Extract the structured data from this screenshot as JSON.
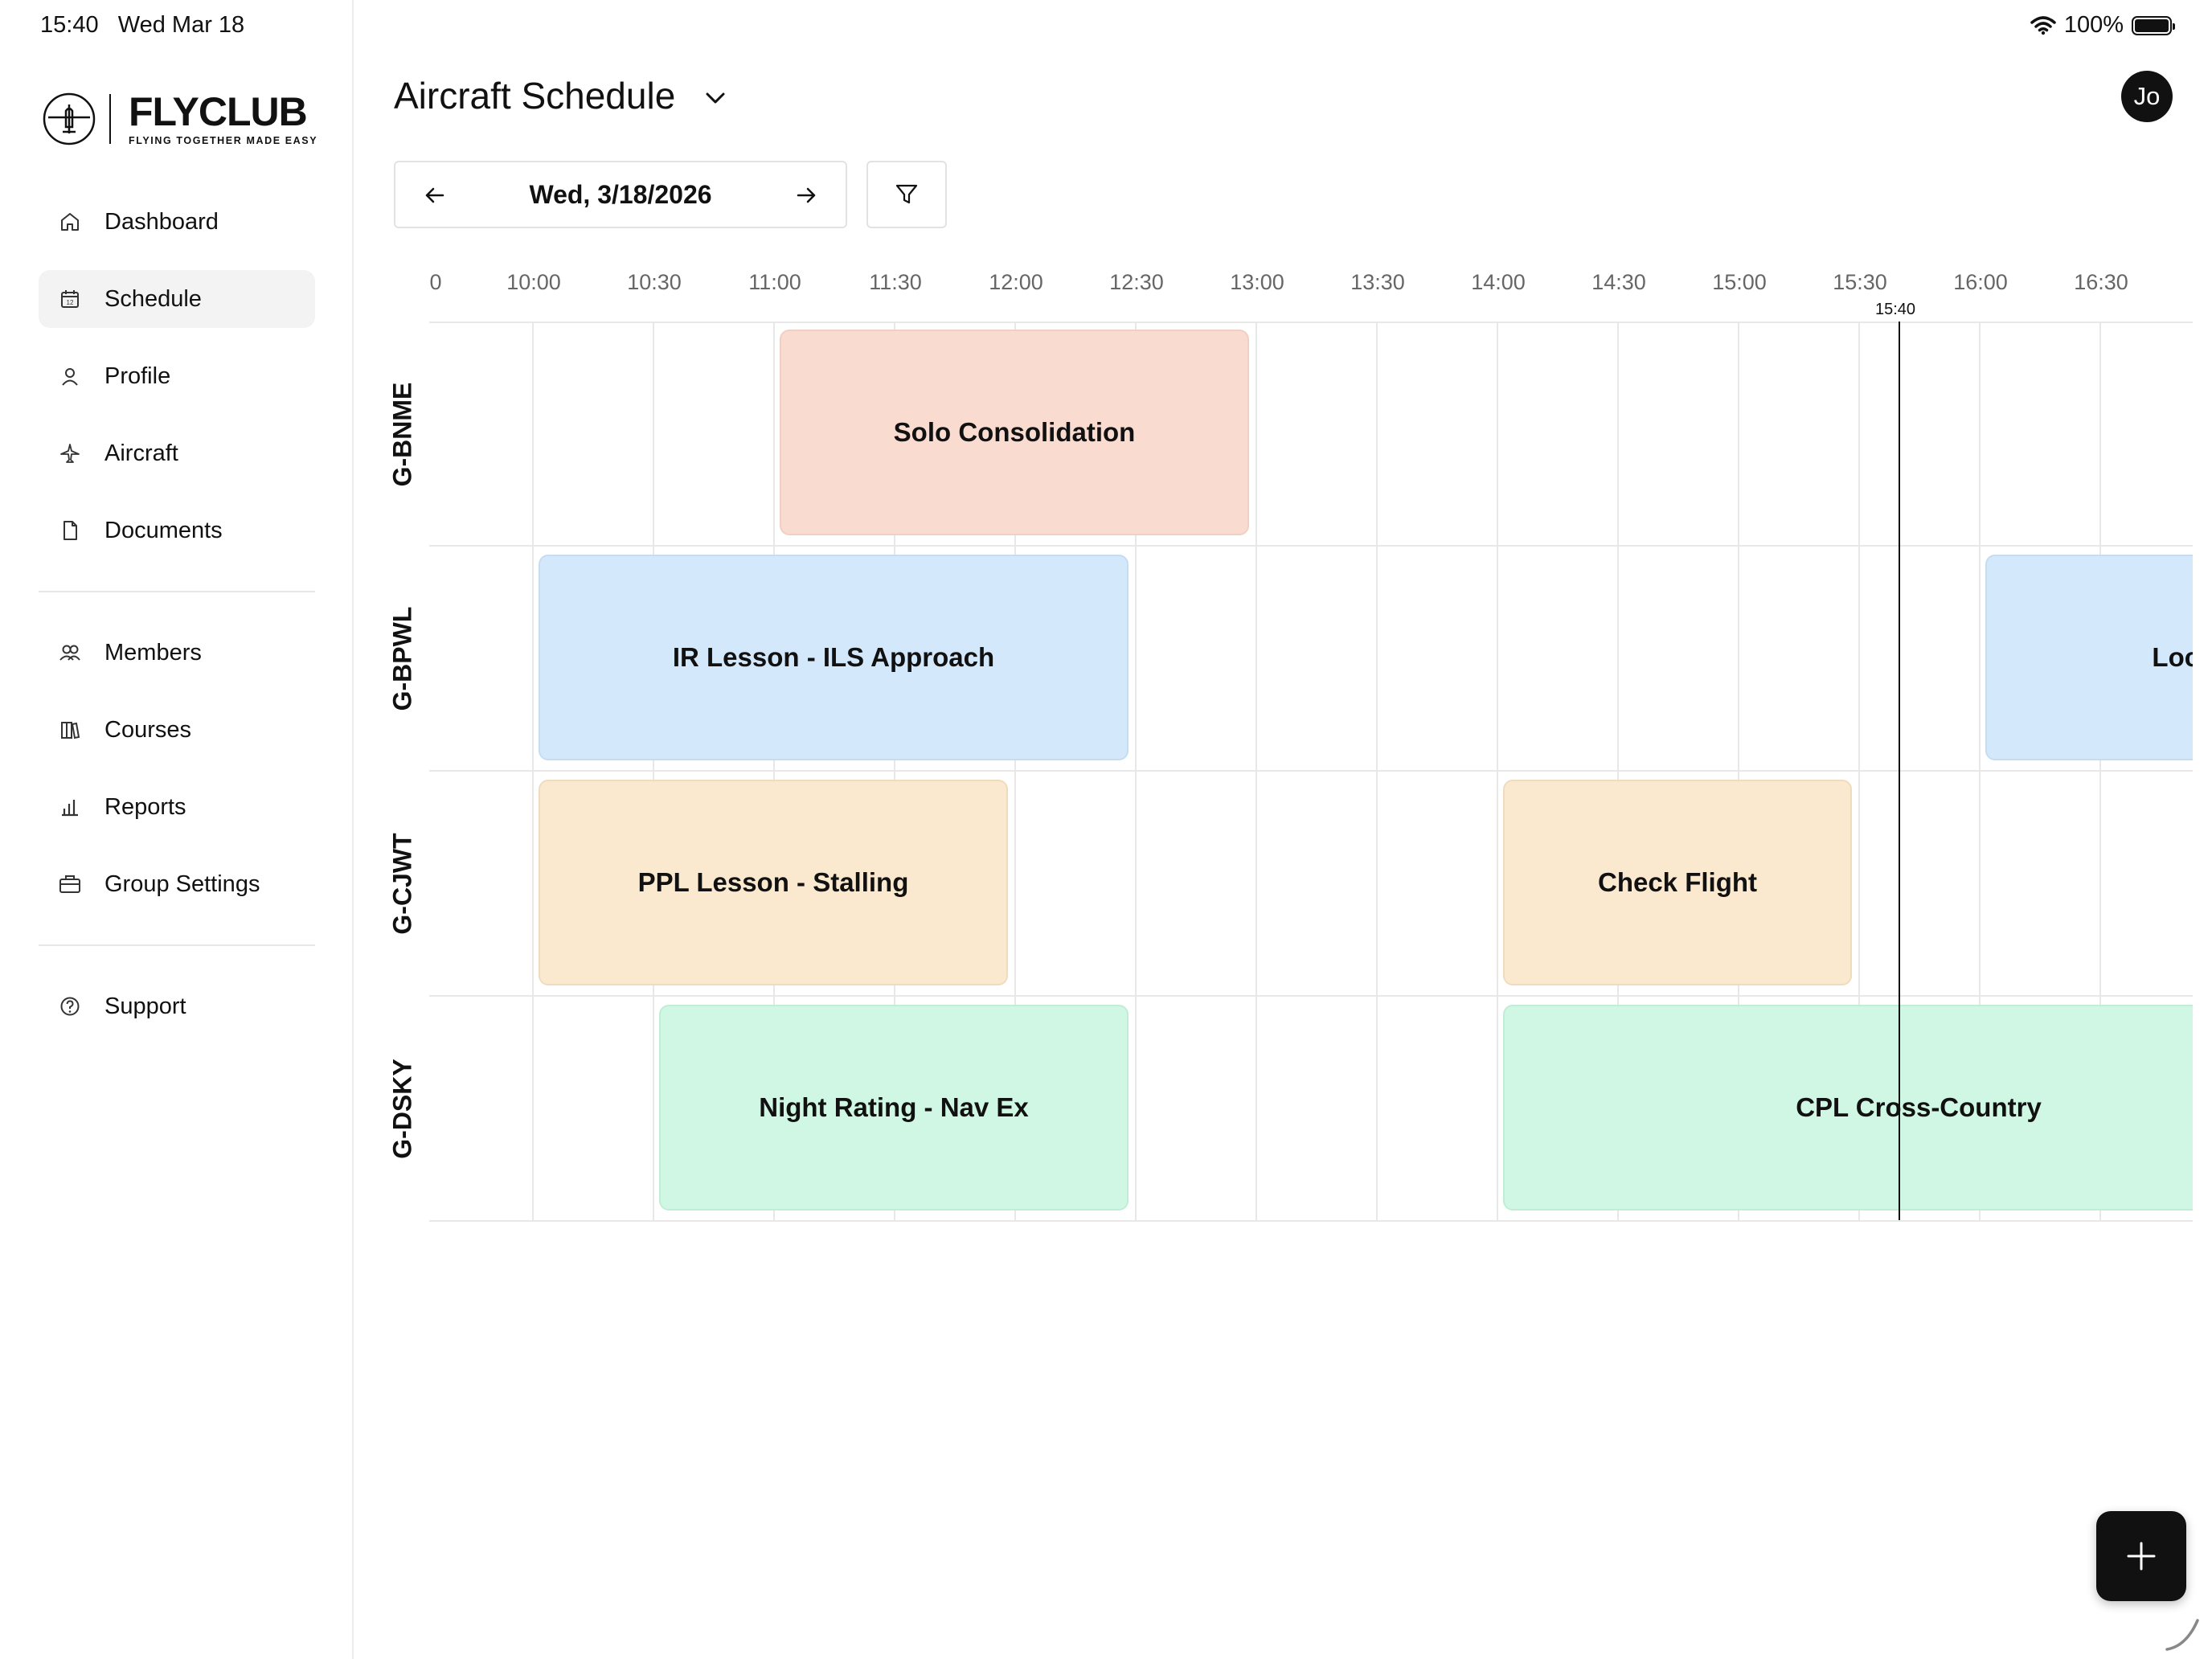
{
  "status_bar": {
    "time": "15:40",
    "date": "Wed Mar 18",
    "battery": "100%"
  },
  "logo": {
    "brand": "FLYCLUB",
    "tagline": "FLYING TOGETHER MADE EASY"
  },
  "sidebar": {
    "primary": [
      {
        "label": "Dashboard",
        "icon": "home-icon"
      },
      {
        "label": "Schedule",
        "icon": "calendar-icon",
        "active": true
      },
      {
        "label": "Profile",
        "icon": "user-icon"
      },
      {
        "label": "Aircraft",
        "icon": "plane-icon"
      },
      {
        "label": "Documents",
        "icon": "document-icon"
      }
    ],
    "secondary": [
      {
        "label": "Members",
        "icon": "users-icon"
      },
      {
        "label": "Courses",
        "icon": "books-icon"
      },
      {
        "label": "Reports",
        "icon": "bar-chart-icon"
      },
      {
        "label": "Group Settings",
        "icon": "briefcase-icon"
      }
    ],
    "tertiary": [
      {
        "label": "Support",
        "icon": "help-circle-icon"
      }
    ]
  },
  "header": {
    "title": "Aircraft Schedule",
    "avatar_initials": "Jo"
  },
  "date_nav": {
    "date": "Wed, 3/18/2026"
  },
  "timeline": {
    "axis_labels": [
      "0",
      "10:00",
      "10:30",
      "11:00",
      "11:30",
      "12:00",
      "12:30",
      "13:00",
      "13:30",
      "14:00",
      "14:30",
      "15:00",
      "15:30",
      "16:00",
      "16:30"
    ],
    "now_label": "15:40",
    "aircraft": [
      "G-BNME",
      "G-BPWL",
      "G-CJWT",
      "G-DSKY"
    ],
    "bookings": [
      {
        "aircraft": "G-BNME",
        "title": "Solo Consolidation",
        "color": "#f9dbd0",
        "border": "#f2cfc3"
      },
      {
        "aircraft": "G-BPWL",
        "title": "IR Lesson - ILS Approach",
        "color": "#d3e8fb",
        "border": "#c5dcf2"
      },
      {
        "aircraft": "G-BPWL",
        "title": "Local Flight",
        "color": "#d3e8fb",
        "border": "#c5dcf2"
      },
      {
        "aircraft": "G-CJWT",
        "title": "PPL Lesson - Stalling",
        "color": "#fae9cf",
        "border": "#f0dcbd"
      },
      {
        "aircraft": "G-CJWT",
        "title": "Check Flight",
        "color": "#fae9cf",
        "border": "#f0dcbd"
      },
      {
        "aircraft": "G-DSKY",
        "title": "Night Rating - Nav Ex",
        "color": "#d0f7e3",
        "border": "#bfeed5"
      },
      {
        "aircraft": "G-DSKY",
        "title": "CPL Cross-Country",
        "color": "#d0f7e3",
        "border": "#bfeed5"
      }
    ]
  }
}
